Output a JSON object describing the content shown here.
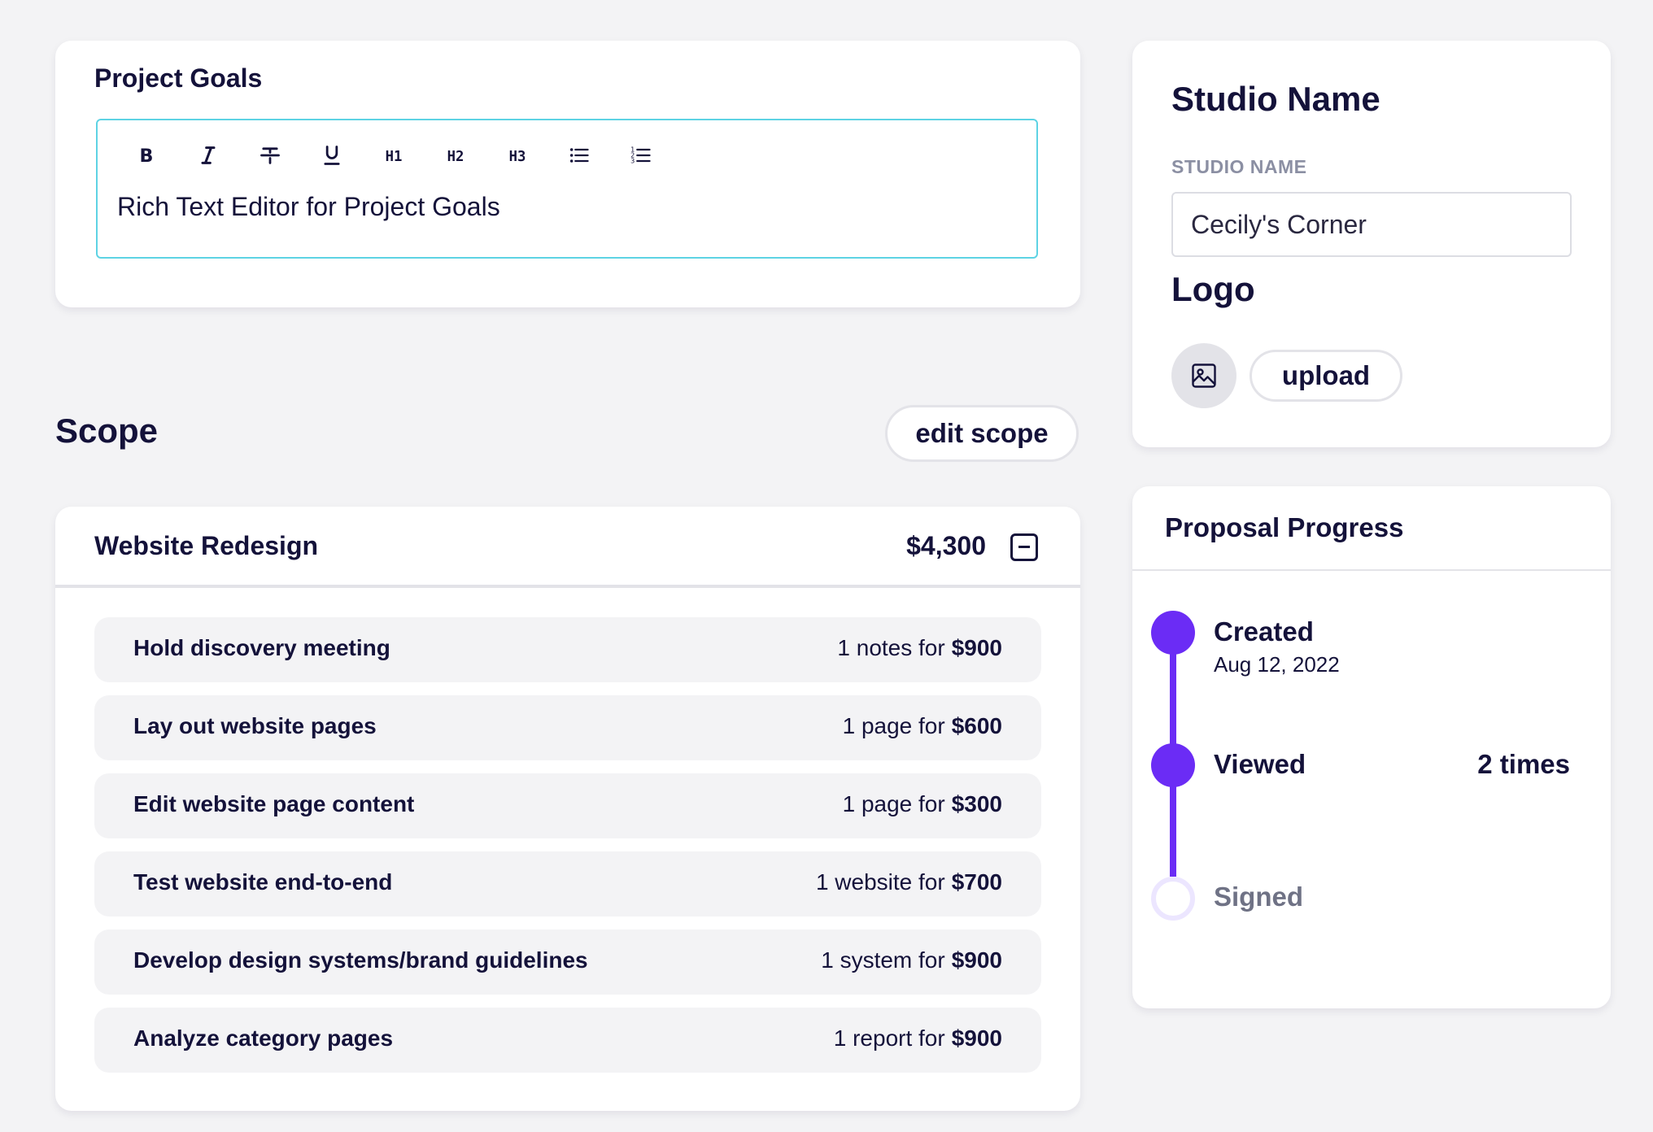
{
  "project_goals": {
    "title": "Project Goals",
    "toolbar": [
      {
        "name": "bold-button",
        "icon": "bold-icon"
      },
      {
        "name": "italic-button",
        "icon": "italic-icon"
      },
      {
        "name": "strikethrough-button",
        "icon": "strikethrough-icon"
      },
      {
        "name": "underline-button",
        "icon": "underline-icon"
      },
      {
        "name": "h1-button",
        "icon": "h1-icon"
      },
      {
        "name": "h2-button",
        "icon": "h2-icon"
      },
      {
        "name": "h3-button",
        "icon": "h3-icon"
      },
      {
        "name": "bullet-list-button",
        "icon": "bullet-list-icon"
      },
      {
        "name": "numbered-list-button",
        "icon": "numbered-list-icon"
      }
    ],
    "editor_text": "Rich Text Editor for Project Goals"
  },
  "scope": {
    "title": "Scope",
    "edit_label": "edit scope",
    "project": {
      "name": "Website Redesign",
      "total": "$4,300",
      "collapse_icon": "minus-square-icon"
    },
    "items": [
      {
        "label": "Hold discovery meeting",
        "qty": "1 notes for",
        "price": "$900"
      },
      {
        "label": "Lay out website pages",
        "qty": "1 page for",
        "price": "$600"
      },
      {
        "label": "Edit website page content",
        "qty": "1 page for",
        "price": "$300"
      },
      {
        "label": "Test website end-to-end",
        "qty": "1 website for",
        "price": "$700"
      },
      {
        "label": "Develop design systems/brand guidelines",
        "qty": "1 system for",
        "price": "$900"
      },
      {
        "label": "Analyze category pages",
        "qty": "1 report for",
        "price": "$900"
      }
    ]
  },
  "studio": {
    "title": "Studio Name",
    "field_label": "STUDIO NAME",
    "field_value": "Cecily's Corner",
    "logo_title": "Logo",
    "logo_icon": "image-icon",
    "upload_label": "upload"
  },
  "progress": {
    "title": "Proposal Progress",
    "accent": "#6b2cf5",
    "steps": [
      {
        "label": "Created",
        "date": "Aug 12, 2022",
        "count": "",
        "done": true
      },
      {
        "label": "Viewed",
        "date": "",
        "count": "2 times",
        "done": true
      },
      {
        "label": "Signed",
        "date": "",
        "count": "",
        "done": false
      }
    ]
  }
}
